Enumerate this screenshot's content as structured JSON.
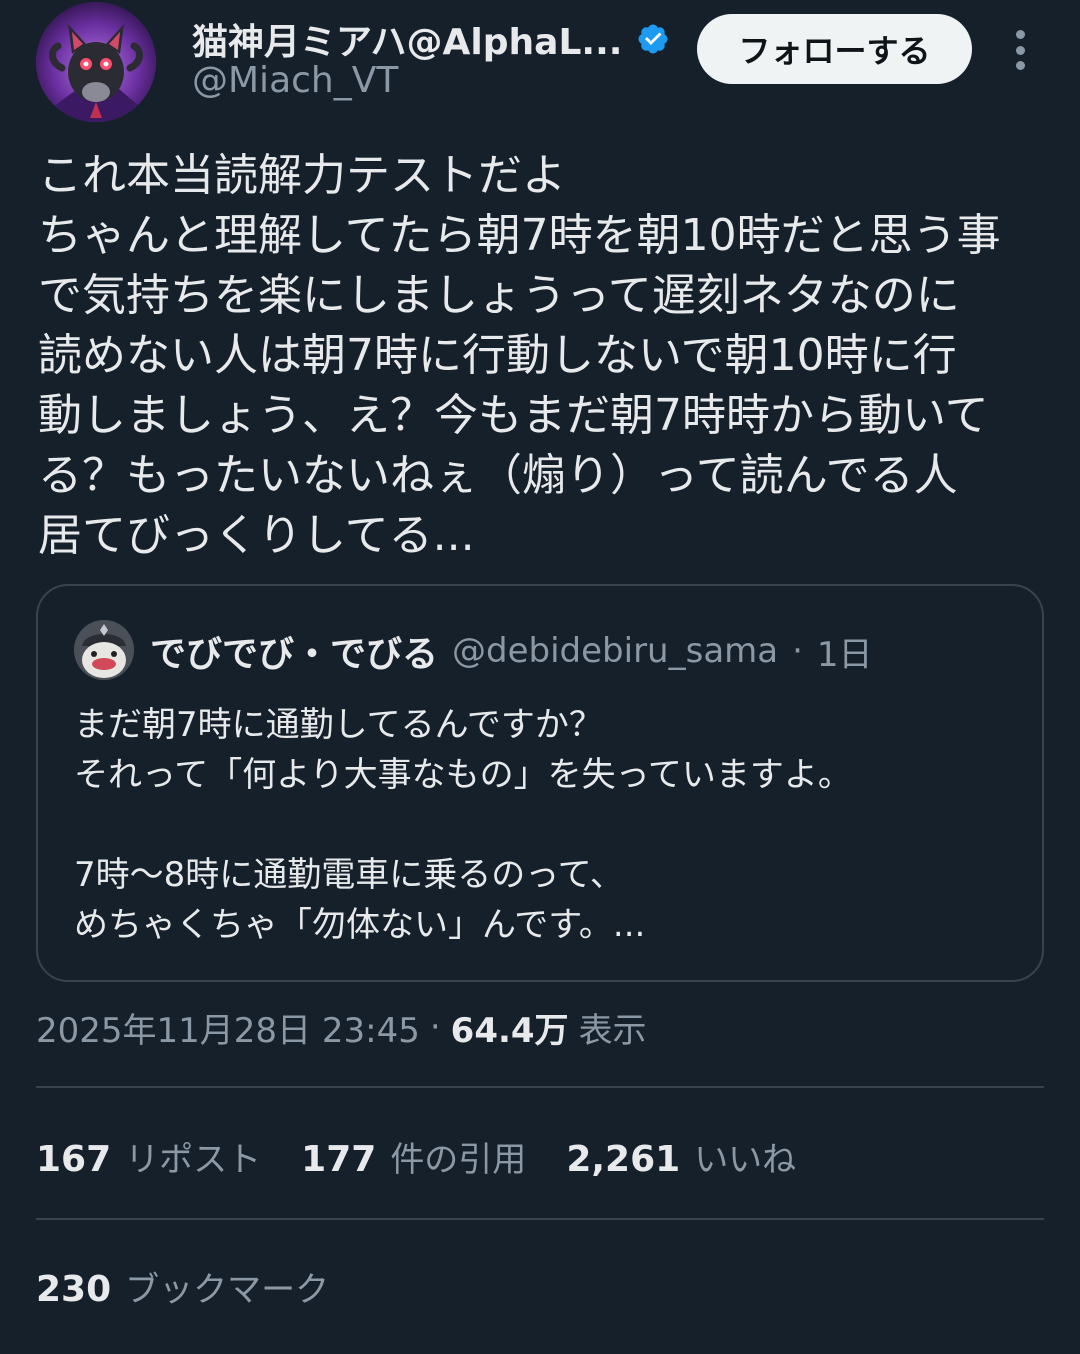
{
  "author": {
    "display_name": "猫神月ミアハ@AlphaL...",
    "handle": "@Miach_VT",
    "verified": true,
    "avatar_icon": "purple-cat-character-avatar"
  },
  "follow_button_label": "フォローする",
  "tweet": {
    "lines": [
      "これ本当読解力テストだよ",
      "ちゃんと理解してたら朝7時を朝10時だと思う事",
      "で気持ちを楽にしましょうって遅刻ネタなのに",
      "読めない人は朝7時に行動しないで朝10時に行",
      "動しましょう、え？今もまだ朝7時時から動いて",
      "る？もったいないねぇ（煽り）って読んでる人",
      "居てびっくりしてる..."
    ]
  },
  "quote": {
    "display_name": "でびでび・でびる",
    "handle": "@debidebiru_sama",
    "separator": "·",
    "time": "1日",
    "avatar_icon": "character-avatar",
    "lines_block1": [
      "まだ朝7時に通勤してるんですか？",
      "それって「何より大事なもの」を失っていますよ。"
    ],
    "lines_block2": [
      "7時〜8時に通勤電車に乗るのって、",
      "めちゃくちゃ「勿体ない」んです。..."
    ]
  },
  "meta": {
    "timestamp": "2025年11月28日 23:45",
    "separator": "·",
    "views": "64.4万",
    "views_label": "表示"
  },
  "stats": {
    "reposts_count": "167",
    "reposts_label": "リポスト",
    "quotes_count": "177",
    "quotes_label": "件の引用",
    "likes_count": "2,261",
    "likes_label": "いいね",
    "bookmarks_count": "230",
    "bookmarks_label": "ブックマーク"
  },
  "colors": {
    "background": "#15202b",
    "text_primary": "#e7e9ea",
    "text_secondary": "#8b98a5",
    "border": "#38444d",
    "verified": "#1d9bf0",
    "follow_button_bg": "#eff3f4"
  }
}
